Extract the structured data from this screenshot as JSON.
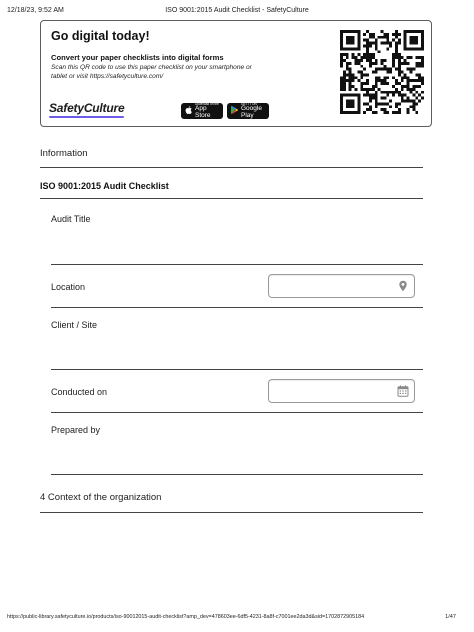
{
  "header": {
    "datetime": "12/18/23, 9:52 AM",
    "title": "ISO 9001:2015 Audit Checklist - SafetyCulture"
  },
  "banner": {
    "headline": "Go digital today!",
    "subheadline": "Convert your paper checklists into digital forms",
    "description": "Scan this QR code to use this paper checklist on your smartphone or tablet or visit https://safetyculture.com/",
    "brand": "SafetyCulture",
    "brand_accent_color": "#6c5ce7",
    "app_store": {
      "small": "Download on the",
      "big": "App Store"
    },
    "google_play": {
      "small": "GET IT ON",
      "big": "Google Play"
    },
    "qr_icon": "qr-code-icon"
  },
  "sections": {
    "information": "Information",
    "checklist_title": "ISO 9001:2015 Audit Checklist",
    "context": "4 Context of the organization"
  },
  "fields": {
    "audit_title": {
      "label": "Audit Title"
    },
    "location": {
      "label": "Location",
      "value": "",
      "icon": "map-pin-icon"
    },
    "client_site": {
      "label": "Client / Site"
    },
    "conducted_on": {
      "label": "Conducted on",
      "value": "",
      "icon": "calendar-icon"
    },
    "prepared_by": {
      "label": "Prepared by"
    }
  },
  "footer": {
    "url": "https://public-library.safetyculture.io/products/iso-90012015-audit-checklist?amp_dev=478603ee-6df5-4231-8a8f-c7001ee2da3d&sid=1702872905184",
    "page": "1/47"
  }
}
